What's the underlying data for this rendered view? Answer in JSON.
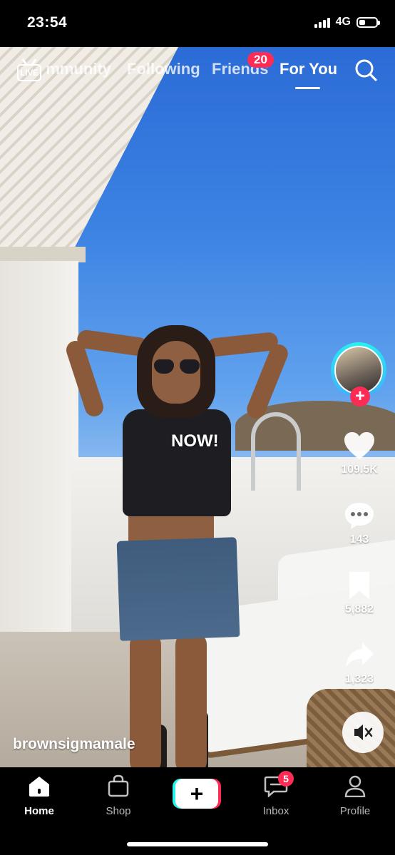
{
  "status_bar": {
    "time": "23:54",
    "network": "4G",
    "battery_level": 0.35
  },
  "top_nav": {
    "tabs": [
      {
        "label": "Community",
        "visible_text": "mmunity"
      },
      {
        "label": "Following"
      },
      {
        "label": "Friends",
        "visible_text": "Friends",
        "badge": "20"
      },
      {
        "label": "For You",
        "active": true
      }
    ],
    "live_label": "LIVE",
    "icons": [
      "live-tv-icon",
      "search-icon"
    ]
  },
  "video": {
    "caption": "NOW!",
    "username": "brownsigmamale"
  },
  "actions": {
    "likes": "109.5K",
    "comments": "143",
    "bookmarks": "5,882",
    "shares": "1,323",
    "follow_plus": "+"
  },
  "bottom_nav": {
    "items": [
      {
        "label": "Home",
        "active": true,
        "icon": "home-icon"
      },
      {
        "label": "Shop",
        "icon": "shopping-bag-icon"
      },
      {
        "label": "",
        "icon": "create-plus-icon",
        "glyph": "+"
      },
      {
        "label": "Inbox",
        "icon": "inbox-icon",
        "badge": "5"
      },
      {
        "label": "Profile",
        "icon": "profile-icon"
      }
    ]
  },
  "colors": {
    "accent_red": "#fe2c55",
    "accent_cyan": "#25f4ee"
  }
}
